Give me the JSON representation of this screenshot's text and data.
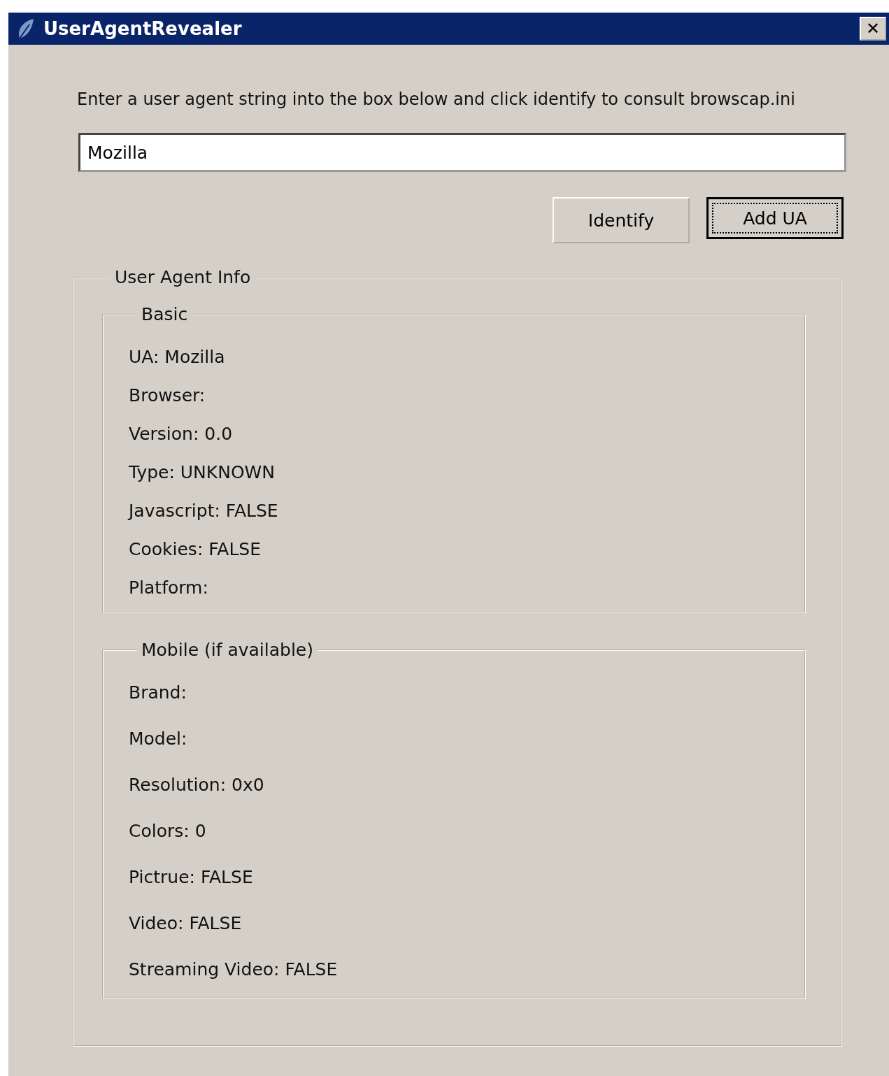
{
  "window": {
    "title": "UserAgentRevealer",
    "close": "✕"
  },
  "instruction": "Enter a user agent string into the box below and click identify to consult browscap.ini",
  "input": {
    "value": "Mozilla"
  },
  "buttons": [
    {
      "label": "Identify",
      "focused": false
    },
    {
      "label": "Add UA",
      "focused": true
    }
  ],
  "info": {
    "title": "User Agent Info",
    "groups": [
      {
        "title": "Basic",
        "items": [
          "UA: Mozilla",
          "Browser:",
          "Version: 0.0",
          "Type: UNKNOWN",
          "Javascript: FALSE",
          "Cookies: FALSE",
          "Platform:"
        ]
      },
      {
        "title": "Mobile (if available)",
        "items": [
          "Brand:",
          "Model:",
          "Resolution: 0x0",
          "Colors: 0",
          "Pictrue: FALSE",
          "Video: FALSE",
          "Streaming Video: FALSE"
        ]
      }
    ]
  }
}
